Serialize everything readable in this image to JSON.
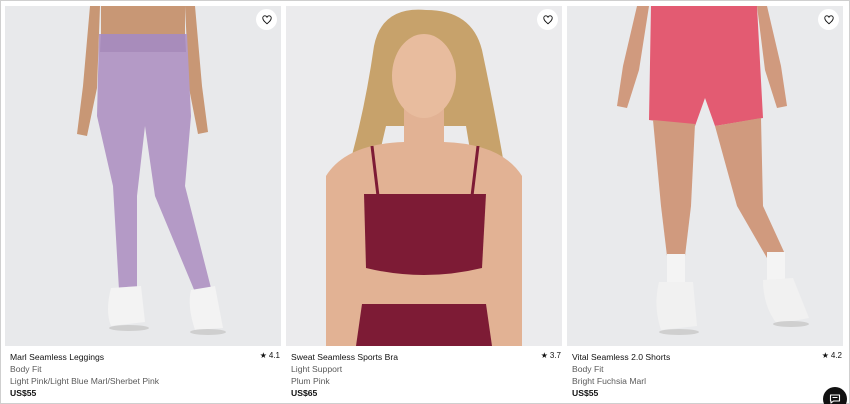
{
  "products": [
    {
      "name": "Marl Seamless Leggings",
      "fit": "Body Fit",
      "color": "Light Pink/Light Blue Marl/Sherbet Pink",
      "price": "US$55",
      "rating": "4.1",
      "image": "model-lilac-leggings"
    },
    {
      "name": "Sweat Seamless Sports Bra",
      "fit": "Light Support",
      "color": "Plum Pink",
      "price": "US$65",
      "rating": "3.7",
      "image": "model-plum-sports-bra"
    },
    {
      "name": "Vital Seamless 2.0 Shorts",
      "fit": "Body Fit",
      "color": "Bright Fuchsia Marl",
      "price": "US$55",
      "rating": "4.2",
      "image": "model-pink-shorts"
    }
  ],
  "icons": {
    "wishlist": "heart-icon",
    "rating": "star-icon",
    "chat": "chat-icon"
  },
  "colors": {
    "photo_bg": "#e9eaec",
    "leggings": "#b49ac6",
    "bra": "#7d1b35",
    "shorts": "#e35b72"
  }
}
